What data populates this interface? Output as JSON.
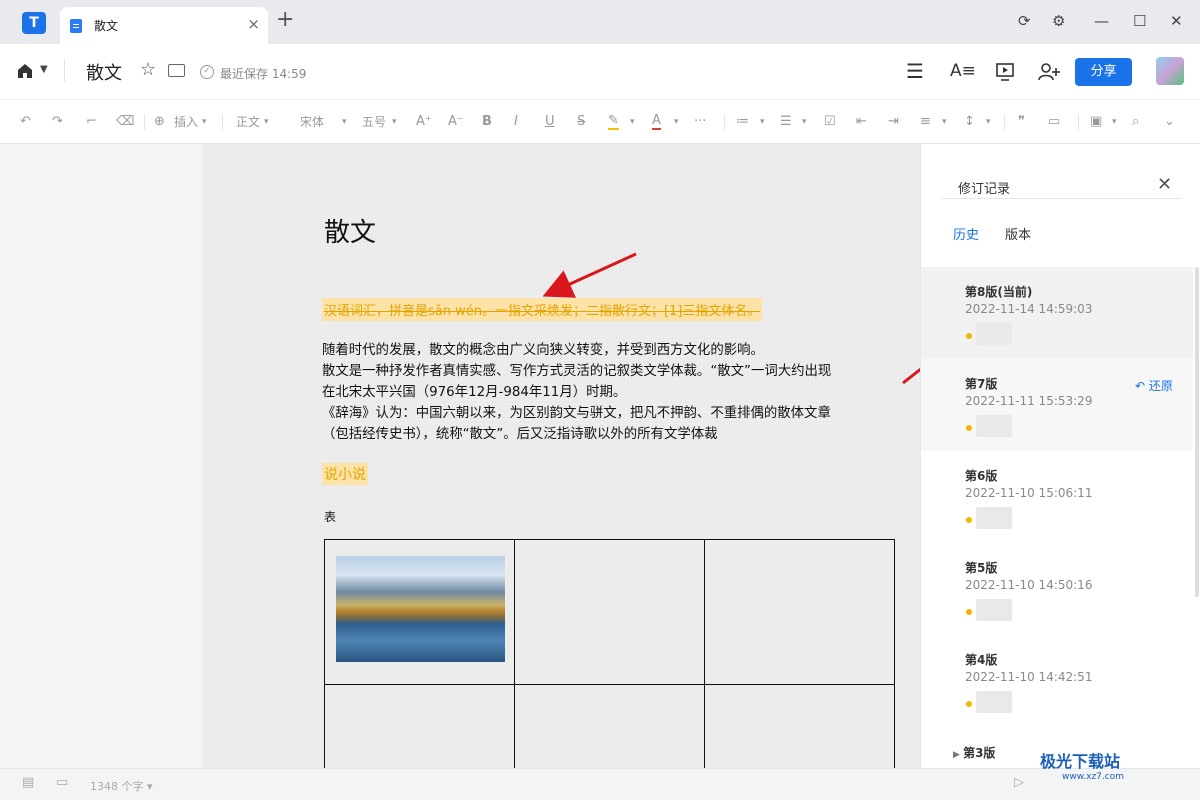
{
  "tab": {
    "label": "散文",
    "close": "×",
    "add": "+"
  },
  "window": {
    "sync": "⟳",
    "settings": "⚙",
    "minimize": "—",
    "maximize": "☐",
    "close": "✕"
  },
  "header": {
    "doc_title": "散文",
    "saved_text": "最近保存 14:59",
    "share_label": "分享"
  },
  "toolbar": {
    "insert": "插入",
    "style": "正文",
    "font": "宋体",
    "size": "五号",
    "more": "···"
  },
  "document": {
    "heading": "散文",
    "deleted_line": "汉语词汇，拼音是sǎn wén。一指文采焕发；二指散行文；[1]三指文体名。",
    "paragraphs": [
      "随着时代的发展，散文的概念由广义向狭义转变，并受到西方文化的影响。",
      "散文是一种抒发作者真情实感、写作方式灵活的记叙类文学体裁。“散文”一词大约出现",
      "在北宋太平兴国（976年12月-984年11月）时期。",
      "《辞海》认为：中国六朝以来，为区别韵文与骈文，把凡不押韵、不重排偶的散体文章",
      "（包括经传史书），统称“散文”。后又泛指诗歌以外的所有文学体裁"
    ],
    "inserted_line": "说小说",
    "table_label": "表"
  },
  "revision_panel": {
    "title": "修订记录",
    "tabs": [
      "历史",
      "版本"
    ],
    "restore_label": "还原",
    "versions": [
      {
        "name": "第8版(当前)",
        "time": "2022-11-14 14:59:03"
      },
      {
        "name": "第7版",
        "time": "2022-11-11 15:53:29"
      },
      {
        "name": "第6版",
        "time": "2022-11-10 15:06:11"
      },
      {
        "name": "第5版",
        "time": "2022-11-10 14:50:16"
      },
      {
        "name": "第4版",
        "time": "2022-11-10 14:42:51"
      }
    ],
    "collapsed_version": "第3版"
  },
  "statusbar": {
    "word_count": "1348 个字"
  },
  "watermark": {
    "name": "极光下载站",
    "url": "www.xz7.com"
  },
  "colors": {
    "accent": "#1a73e8",
    "highlight_bg": "#fde3a8",
    "highlight_text": "#e6a400",
    "arrow": "#d9161c"
  }
}
